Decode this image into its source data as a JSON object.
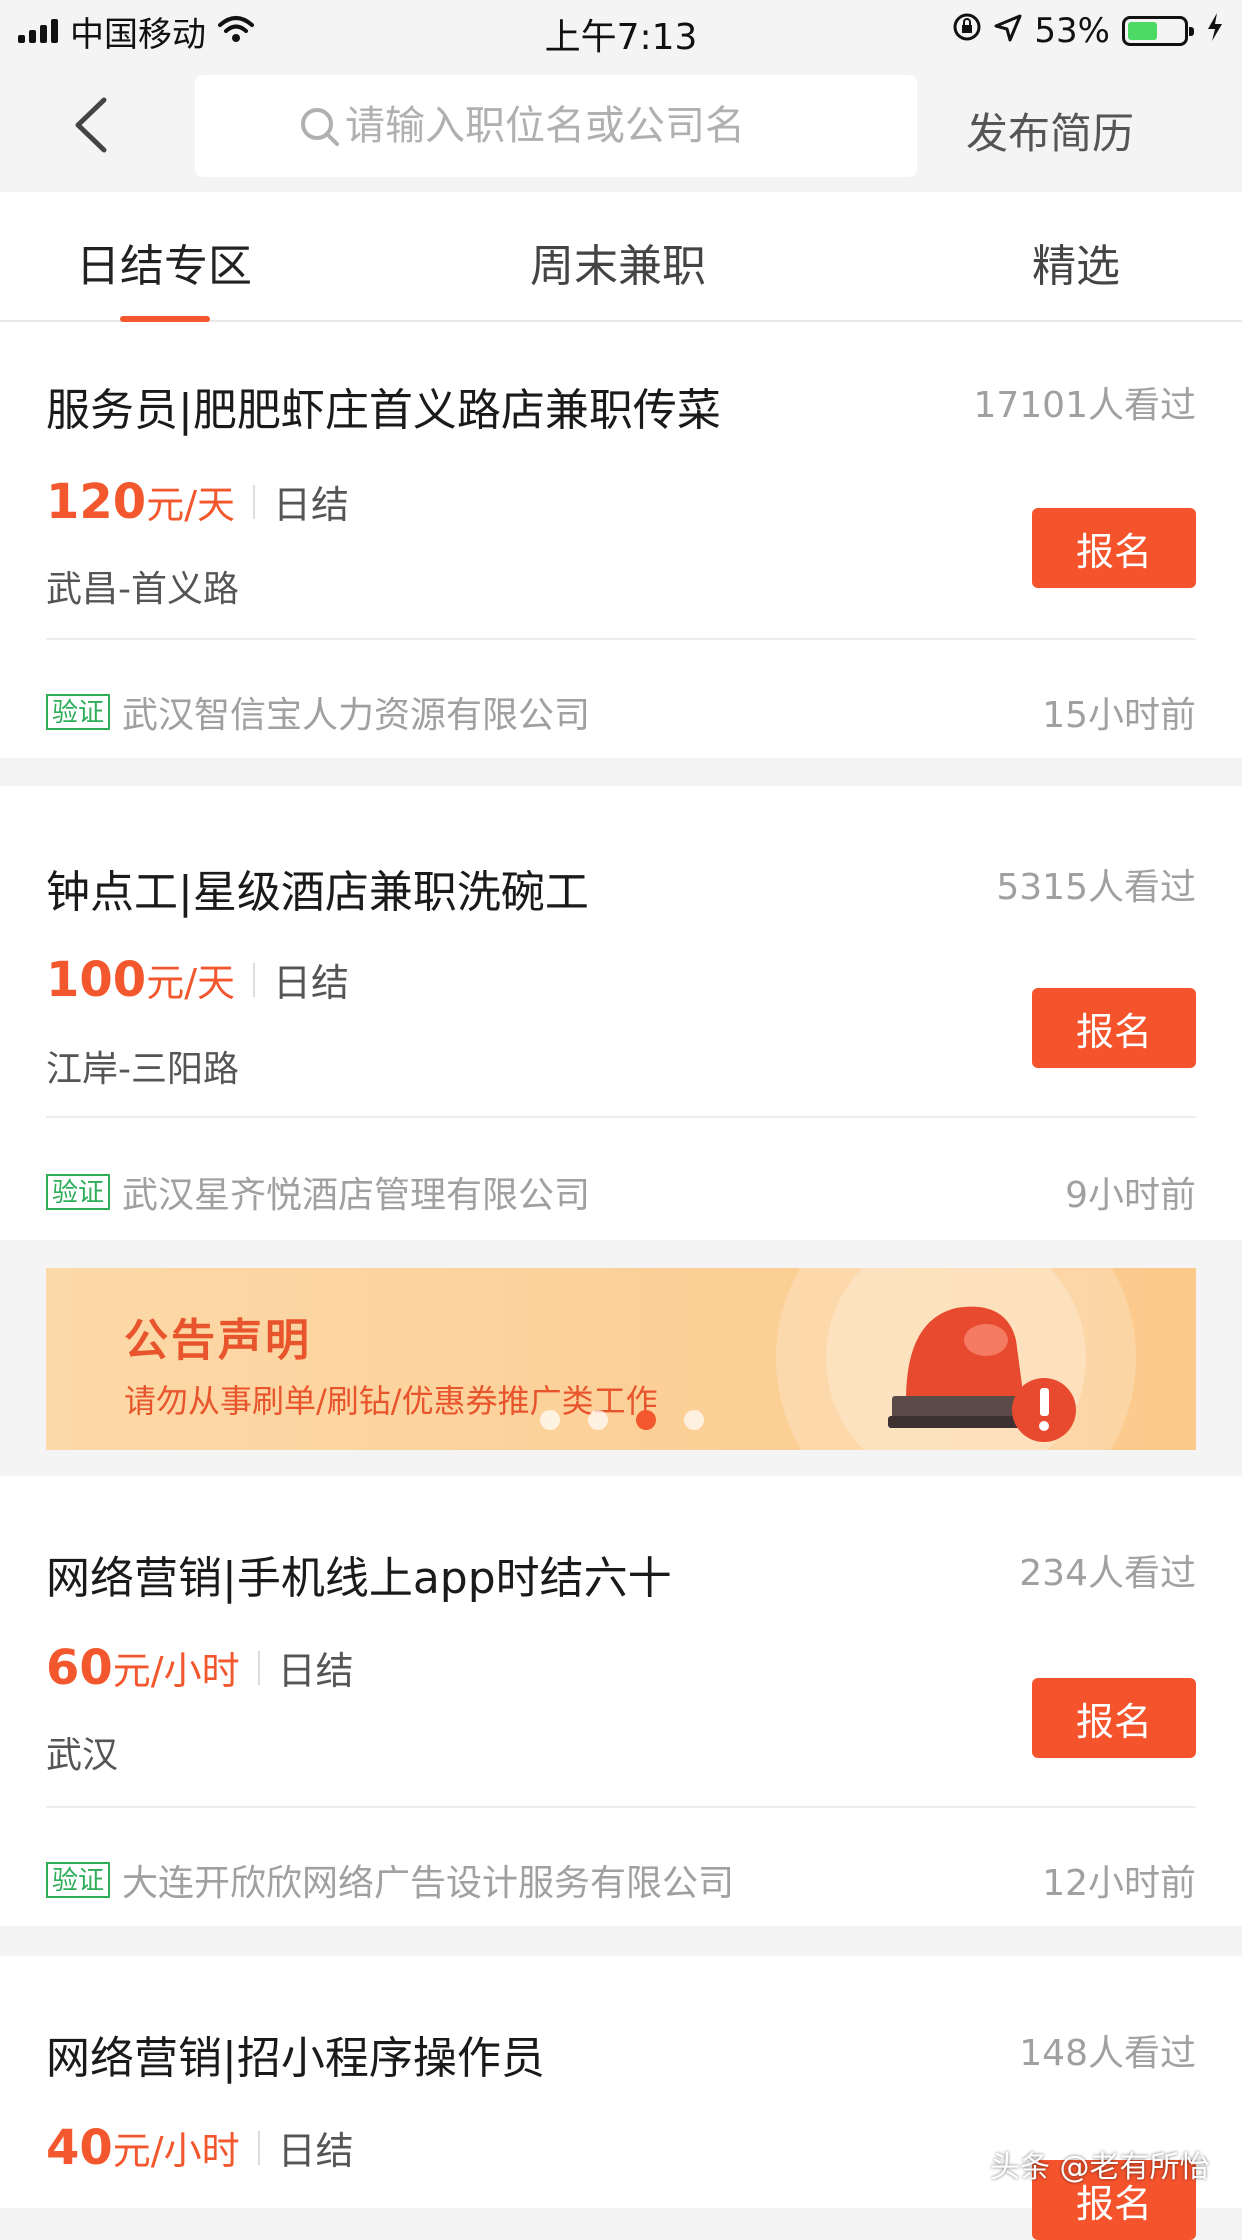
{
  "status_bar": {
    "carrier": "中国移动",
    "time": "上午7:13",
    "battery_percent": "53%",
    "battery_level": 0.53
  },
  "nav": {
    "search_placeholder": "请输入职位名或公司名",
    "post_resume": "发布简历"
  },
  "tabs": [
    {
      "label": "日结专区",
      "active": true
    },
    {
      "label": "周末兼职",
      "active": false
    },
    {
      "label": "精选",
      "active": false
    }
  ],
  "jobs": [
    {
      "title": "服务员|肥肥虾庄首义路店兼职传菜",
      "views": "17101人看过",
      "salary_amount": "120",
      "salary_unit": "元/天",
      "settlement": "日结",
      "location": "武昌-首义路",
      "apply_label": "报名",
      "verify_label": "验证",
      "company": "武汉智信宝人力资源有限公司",
      "posted": "15小时前"
    },
    {
      "title": "钟点工|星级酒店兼职洗碗工",
      "views": "5315人看过",
      "salary_amount": "100",
      "salary_unit": "元/天",
      "settlement": "日结",
      "location": "江岸-三阳路",
      "apply_label": "报名",
      "verify_label": "验证",
      "company": "武汉星齐悦酒店管理有限公司",
      "posted": "9小时前"
    },
    {
      "title": "网络营销|手机线上app时结六十",
      "views": "234人看过",
      "salary_amount": "60",
      "salary_unit": "元/小时",
      "settlement": "日结",
      "location": "武汉",
      "apply_label": "报名",
      "verify_label": "验证",
      "company": "大连开欣欣网络广告设计服务有限公司",
      "posted": "12小时前"
    },
    {
      "title": "网络营销|招小程序操作员",
      "views": "148人看过",
      "salary_amount": "40",
      "salary_unit": "元/小时",
      "settlement": "日结",
      "apply_label": "报名"
    }
  ],
  "banner": {
    "title": "公告声明",
    "subtitle": "请勿从事刷单/刷钻/优惠券推广类工作",
    "slide_count": 4,
    "active_slide": 3
  },
  "watermark": "头条 @老有所怡",
  "colors": {
    "accent": "#f2572d",
    "apply_button": "#f5532c",
    "verify_green": "#2fae5a",
    "banner_bg": "#fcd9a8"
  },
  "icons": [
    "signal-icon",
    "wifi-icon",
    "rotation-lock-icon",
    "location-arrow-icon",
    "battery-icon",
    "charging-bolt-icon",
    "back-chevron-icon",
    "search-icon",
    "siren-icon"
  ]
}
